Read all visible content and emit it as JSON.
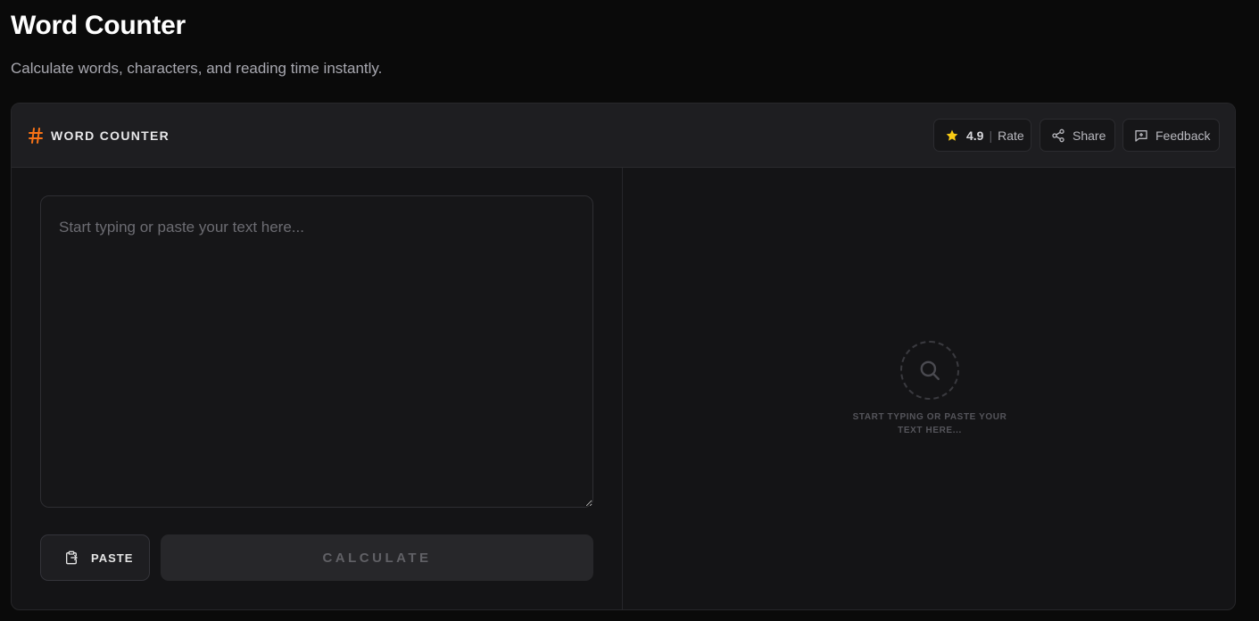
{
  "page": {
    "title": "Word Counter",
    "subtitle": "Calculate words, characters, and reading time instantly."
  },
  "card": {
    "title": "WORD COUNTER",
    "title_icon": "hash-icon",
    "accent_color": "#f97316"
  },
  "header_actions": {
    "rating": "4.9",
    "separator": "|",
    "rate_label": "Rate",
    "share_label": "Share",
    "feedback_label": "Feedback",
    "star_color": "#facc15"
  },
  "editor": {
    "value": "",
    "placeholder": "Start typing or paste your text here..."
  },
  "actions": {
    "paste_label": "PASTE",
    "calculate_label": "CALCULATE"
  },
  "results": {
    "empty_message": "START TYPING OR PASTE YOUR TEXT HERE...",
    "empty_icon": "search-icon"
  }
}
